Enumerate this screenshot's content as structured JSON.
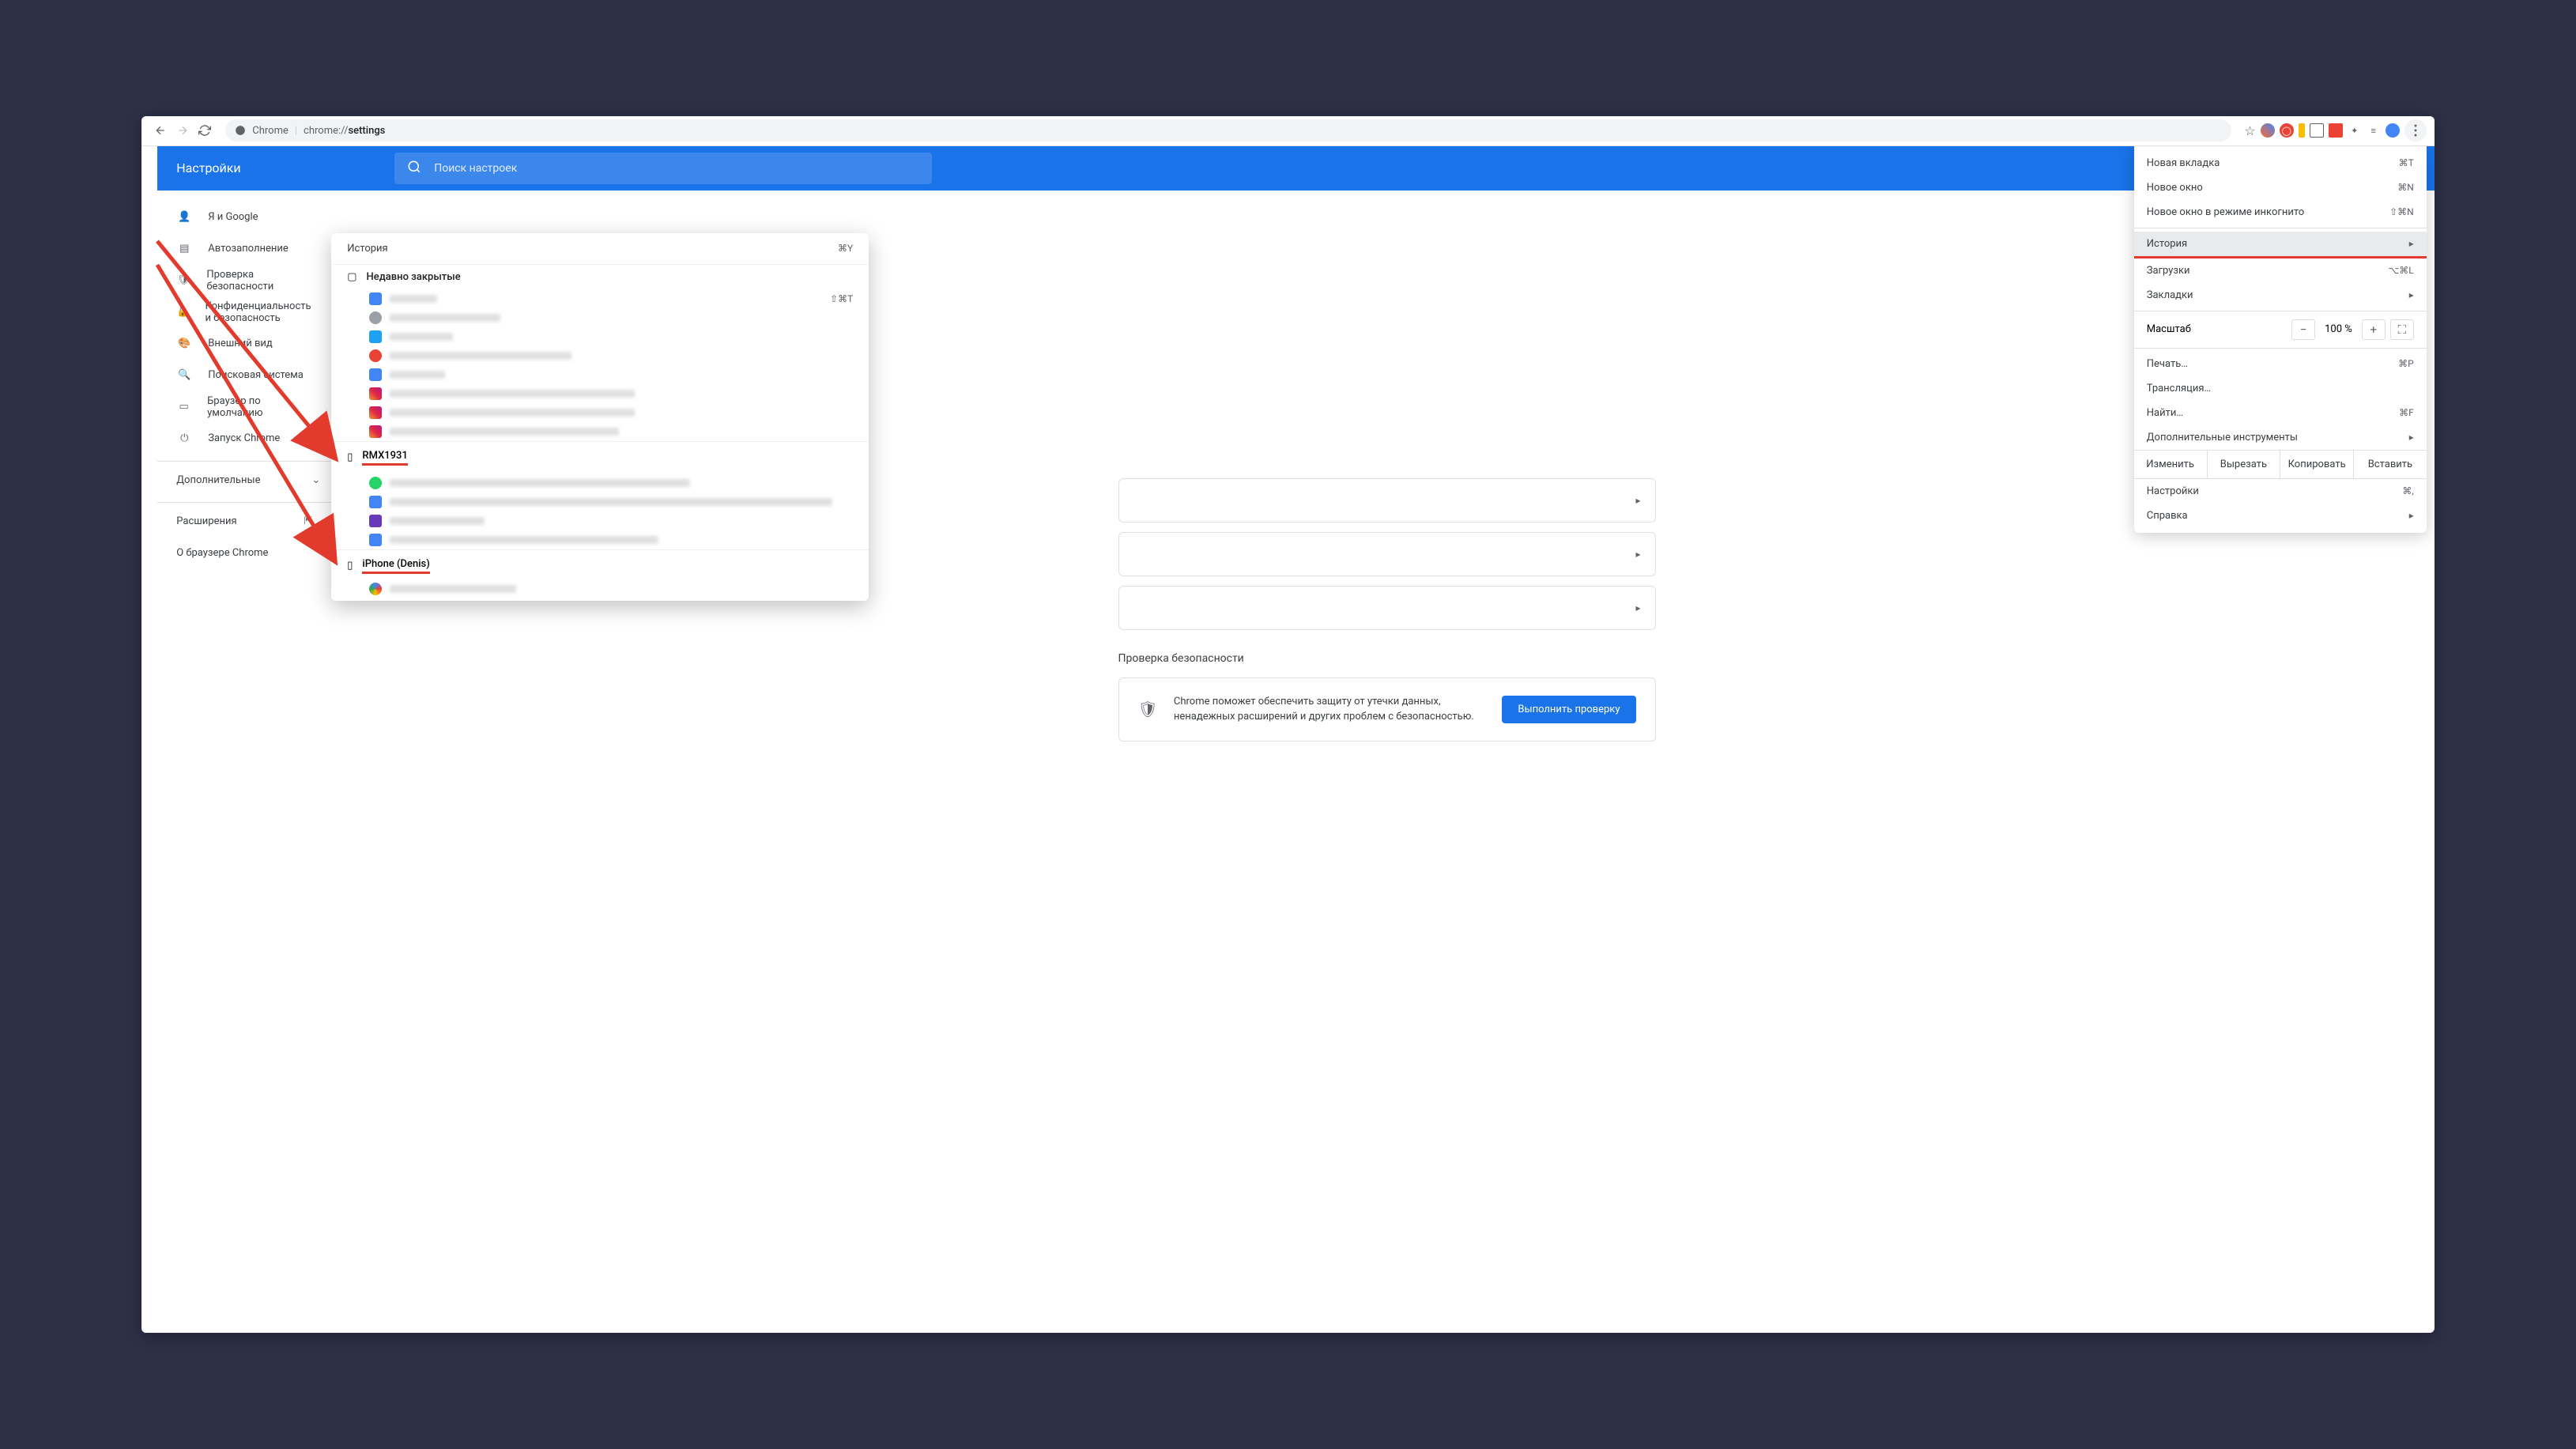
{
  "toolbar": {
    "address_prefix": "Chrome",
    "address_url_prefix": "chrome://",
    "address_url_bold": "settings"
  },
  "header": {
    "title": "Настройки",
    "search_placeholder": "Поиск настроек"
  },
  "sidebar": {
    "items": [
      {
        "label": "Я и Google"
      },
      {
        "label": "Автозаполнение"
      },
      {
        "label": "Проверка безопасности"
      },
      {
        "label": "Конфиденциальность и безопасность"
      },
      {
        "label": "Внешний вид"
      },
      {
        "label": "Поисковая система"
      },
      {
        "label": "Браузер по умолчанию"
      },
      {
        "label": "Запуск Chrome"
      }
    ],
    "advanced": "Дополнительные",
    "extensions": "Расширения",
    "about": "О браузере Chrome"
  },
  "main": {
    "security_title": "Проверка безопасности",
    "security_text": "Chrome поможет обеспечить защиту от утечки данных, ненадежных расширений и других проблем с безопасностью.",
    "security_btn": "Выполнить проверку"
  },
  "history_popup": {
    "title": "История",
    "shortcut": "⌘Y",
    "recent": "Недавно закрытые",
    "reopen_shortcut": "⇧⌘T",
    "device1": "RMX1931",
    "device2": "iPhone (Denis)"
  },
  "menu": {
    "new_tab": {
      "label": "Новая вкладка",
      "kbd": "⌘T"
    },
    "new_window": {
      "label": "Новое окно",
      "kbd": "⌘N"
    },
    "incognito": {
      "label": "Новое окно в режиме инкогнито",
      "kbd": "⇧⌘N"
    },
    "history": {
      "label": "История"
    },
    "downloads": {
      "label": "Загрузки",
      "kbd": "⌥⌘L"
    },
    "bookmarks": {
      "label": "Закладки"
    },
    "zoom": {
      "label": "Масштаб",
      "value": "100 %"
    },
    "print": {
      "label": "Печать…",
      "kbd": "⌘P"
    },
    "cast": {
      "label": "Трансляция…"
    },
    "find": {
      "label": "Найти…",
      "kbd": "⌘F"
    },
    "more_tools": {
      "label": "Дополнительные инструменты"
    },
    "edit": {
      "change": "Изменить",
      "cut": "Вырезать",
      "copy": "Копировать",
      "paste": "Вставить"
    },
    "settings": {
      "label": "Настройки",
      "kbd": "⌘,"
    },
    "help": {
      "label": "Справка"
    }
  }
}
